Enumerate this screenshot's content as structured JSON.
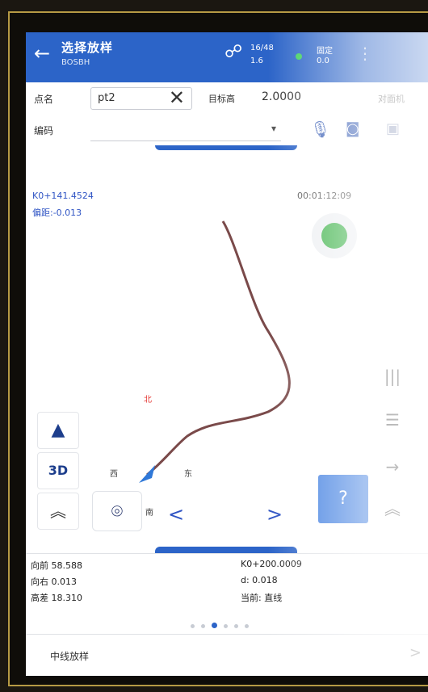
{
  "header": {
    "title": "选择放样",
    "subtitle": "BOSBH",
    "sat_line1": "16/48",
    "sat_line2": "1.6",
    "fix_line1": "固定",
    "fix_line2": "0.0",
    "colors": {
      "bar": "#2c64c8",
      "fix_dot": "#3ccf5a"
    }
  },
  "form": {
    "point_name_label": "点名",
    "point_name_value": "pt2",
    "height_label": "目标高",
    "height_value": "2.0000",
    "height_more": "对面机",
    "code_label": "编码",
    "code_value": ""
  },
  "map": {
    "k_line1": "K0+141.4524",
    "k_line2": "偏距:-0.013",
    "timer": "00:01:12:09",
    "status_color": "#3fb34b",
    "compass": {
      "north": "北",
      "east": "东",
      "west": "西",
      "south": "南"
    },
    "buttons": {
      "nav_glyph": "▲",
      "three_d": "3D",
      "up_glyph": "︽",
      "prev": "<",
      "next": ">",
      "help": "?"
    }
  },
  "info": {
    "left": [
      "向前 58.588",
      "向右 0.013",
      "高差 18.310"
    ],
    "right": [
      "K0+200.0009",
      "d: 0.018",
      "当前: 直线"
    ],
    "page_dots": 6,
    "active_dot": 2
  },
  "footer": {
    "label": "中线放样",
    "arrow": ">"
  }
}
